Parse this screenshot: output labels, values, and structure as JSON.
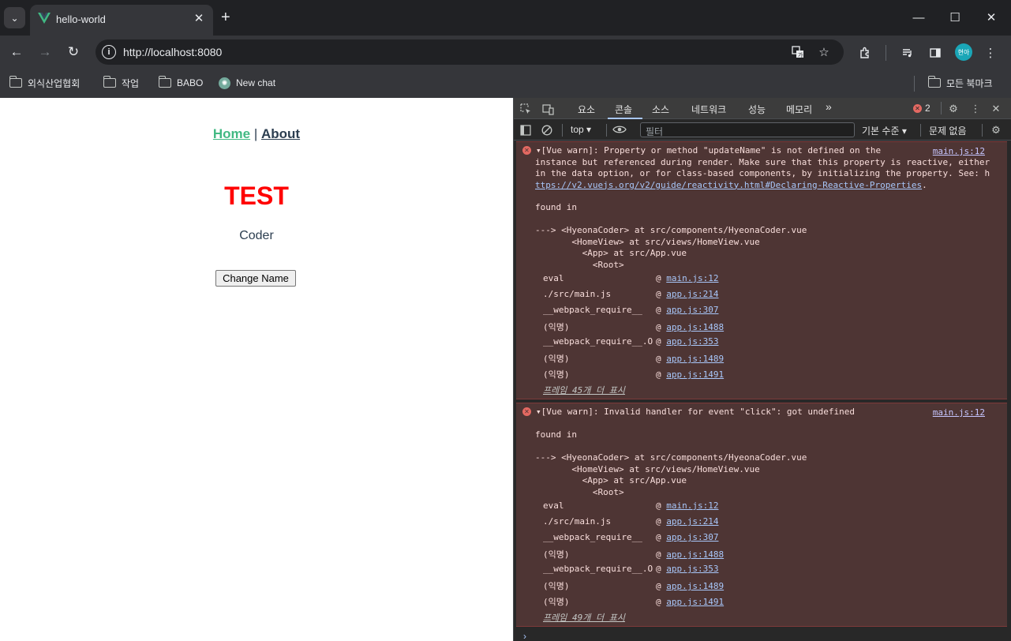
{
  "tabstrip": {
    "tab_title": "hello-world",
    "tab_close": "✕",
    "new_tab": "+",
    "menu": "⌄",
    "minimize": "—",
    "maximize": "☐",
    "close": "✕"
  },
  "toolbar": {
    "back": "←",
    "forward": "→",
    "reload": "↻",
    "url": "http://localhost:8080",
    "info": "i",
    "avatar_text": "현아"
  },
  "bookmarks": {
    "items": [
      "외식산업협회",
      "작업",
      "BABO",
      "New chat"
    ],
    "all_bookmarks": "모든 북마크"
  },
  "page": {
    "nav_home": "Home",
    "nav_sep": " | ",
    "nav_about": "About",
    "title": "TEST",
    "subtitle": "Coder",
    "button": "Change Name"
  },
  "devtools": {
    "tabs": [
      "요소",
      "콘솔",
      "소스",
      "네트워크",
      "성능",
      "메모리"
    ],
    "more_tabs": "»",
    "error_count": "2",
    "context": "top",
    "filter_placeholder": "필터",
    "level": "기본 수준",
    "issues": "문제 없음",
    "prompt": "›",
    "messages": [
      {
        "source": "main.js:12",
        "lines": [
          "▾[Vue warn]: Property or method \"updateName\" is not defined on the",
          "instance but referenced during render. Make sure that this property is reactive, either",
          "in the data option, or for class-based components, by initializing the property. See: h"
        ],
        "link": "ttps://v2.vuejs.org/v2/guide/reactivity.html#Declaring-Reactive-Properties",
        "link_suffix": ".",
        "found_in": "found in",
        "tree": [
          "---> <HyeonaCoder> at src/components/HyeonaCoder.vue",
          "       <HomeView> at src/views/HomeView.vue",
          "         <App> at src/App.vue",
          "           <Root>"
        ],
        "stack": [
          {
            "fn": "eval",
            "at": "@",
            "loc": "main.js:12"
          },
          {
            "fn": "./src/main.js",
            "at": "@",
            "loc": "app.js:214"
          },
          {
            "fn": "__webpack_require__",
            "at": "@",
            "loc": "app.js:307"
          },
          {
            "fn": "(익명)",
            "at": "@",
            "loc": "app.js:1488"
          },
          {
            "fn": "__webpack_require__.O",
            "at": "@",
            "loc": "app.js:353"
          },
          {
            "fn": "(익명)",
            "at": "@",
            "loc": "app.js:1489"
          },
          {
            "fn": "(익명)",
            "at": "@",
            "loc": "app.js:1491"
          }
        ],
        "more": "프레임 45개 더 표시"
      },
      {
        "source": "main.js:12",
        "lines": [
          "▾[Vue warn]: Invalid handler for event \"click\": got undefined"
        ],
        "found_in": "found in",
        "tree": [
          "---> <HyeonaCoder> at src/components/HyeonaCoder.vue",
          "       <HomeView> at src/views/HomeView.vue",
          "         <App> at src/App.vue",
          "           <Root>"
        ],
        "stack": [
          {
            "fn": "eval",
            "at": "@",
            "loc": "main.js:12"
          },
          {
            "fn": "./src/main.js",
            "at": "@",
            "loc": "app.js:214"
          },
          {
            "fn": "__webpack_require__",
            "at": "@",
            "loc": "app.js:307"
          },
          {
            "fn": "(익명)",
            "at": "@",
            "loc": "app.js:1488"
          },
          {
            "fn": "__webpack_require__.O",
            "at": "@",
            "loc": "app.js:353"
          },
          {
            "fn": "(익명)",
            "at": "@",
            "loc": "app.js:1489"
          },
          {
            "fn": "(익명)",
            "at": "@",
            "loc": "app.js:1491"
          }
        ],
        "more": "프레임 49개 더 표시"
      }
    ]
  }
}
